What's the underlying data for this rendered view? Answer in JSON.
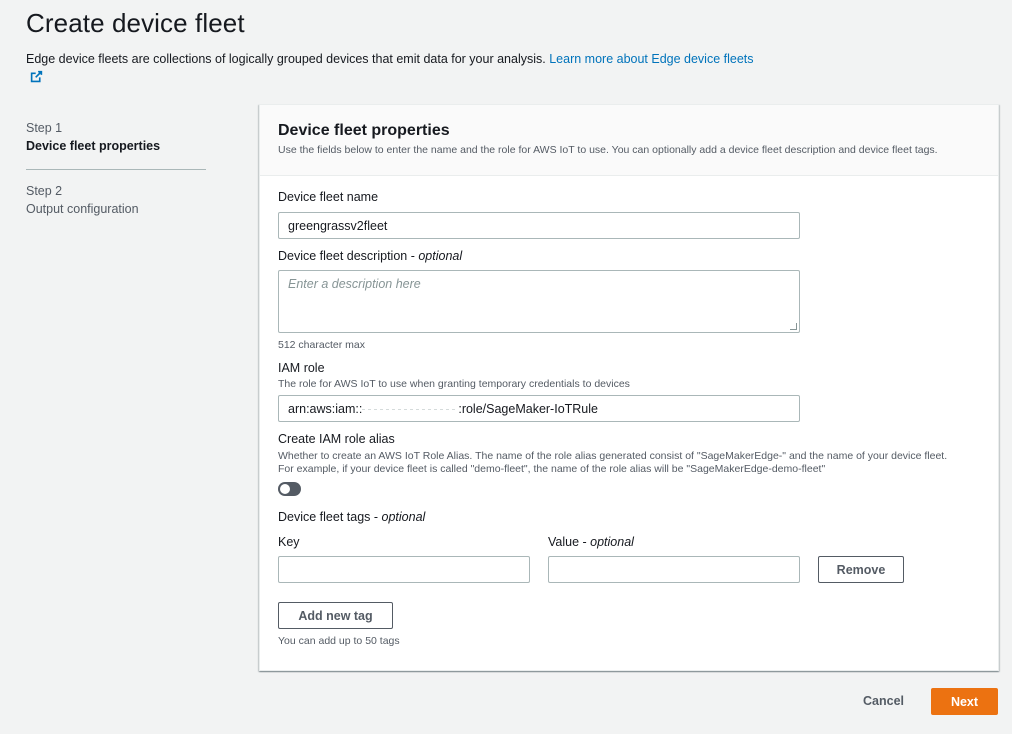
{
  "page": {
    "title": "Create device fleet",
    "description": "Edge device fleets are collections of logically grouped devices that emit data for your analysis.",
    "learn_more_link": "Learn more about Edge device fleets"
  },
  "steps": [
    {
      "number": "Step 1",
      "title": "Device fleet properties",
      "active": true
    },
    {
      "number": "Step 2",
      "title": "Output configuration",
      "active": false
    }
  ],
  "panel": {
    "title": "Device fleet properties",
    "subtitle": "Use the fields below to enter the name and the role for AWS IoT to use. You can optionally add a device fleet description and device fleet tags."
  },
  "form": {
    "fleet_name": {
      "label": "Device fleet name",
      "value": "greengrassv2fleet"
    },
    "description": {
      "label": "Device fleet description",
      "optional": "optional",
      "placeholder": "Enter a description here",
      "hint": "512 character max"
    },
    "iam_role": {
      "label": "IAM role",
      "hint": "The role for AWS IoT to use when granting temporary credentials to devices",
      "value_prefix": "arn:aws:iam::",
      "value_suffix": ":role/SageMaker-IoTRule"
    },
    "role_alias": {
      "label": "Create IAM role alias",
      "hint_line1": "Whether to create an AWS IoT Role Alias. The name of the role alias generated consist of \"SageMakerEdge-\" and the name of your device fleet.",
      "hint_line2": "For example, if your device fleet is called \"demo-fleet\", the name of the role alias will be \"SageMakerEdge-demo-fleet\"",
      "enabled": false
    },
    "tags": {
      "label": "Device fleet tags",
      "optional": "optional",
      "key_label": "Key",
      "value_label": "Value",
      "value_optional": "optional",
      "remove_label": "Remove",
      "add_label": "Add new tag",
      "hint": "You can add up to 50 tags"
    }
  },
  "footer": {
    "cancel_label": "Cancel",
    "next_label": "Next"
  },
  "colors": {
    "accent": "#ec7211",
    "link": "#0073bb",
    "background": "#f2f3f3"
  }
}
